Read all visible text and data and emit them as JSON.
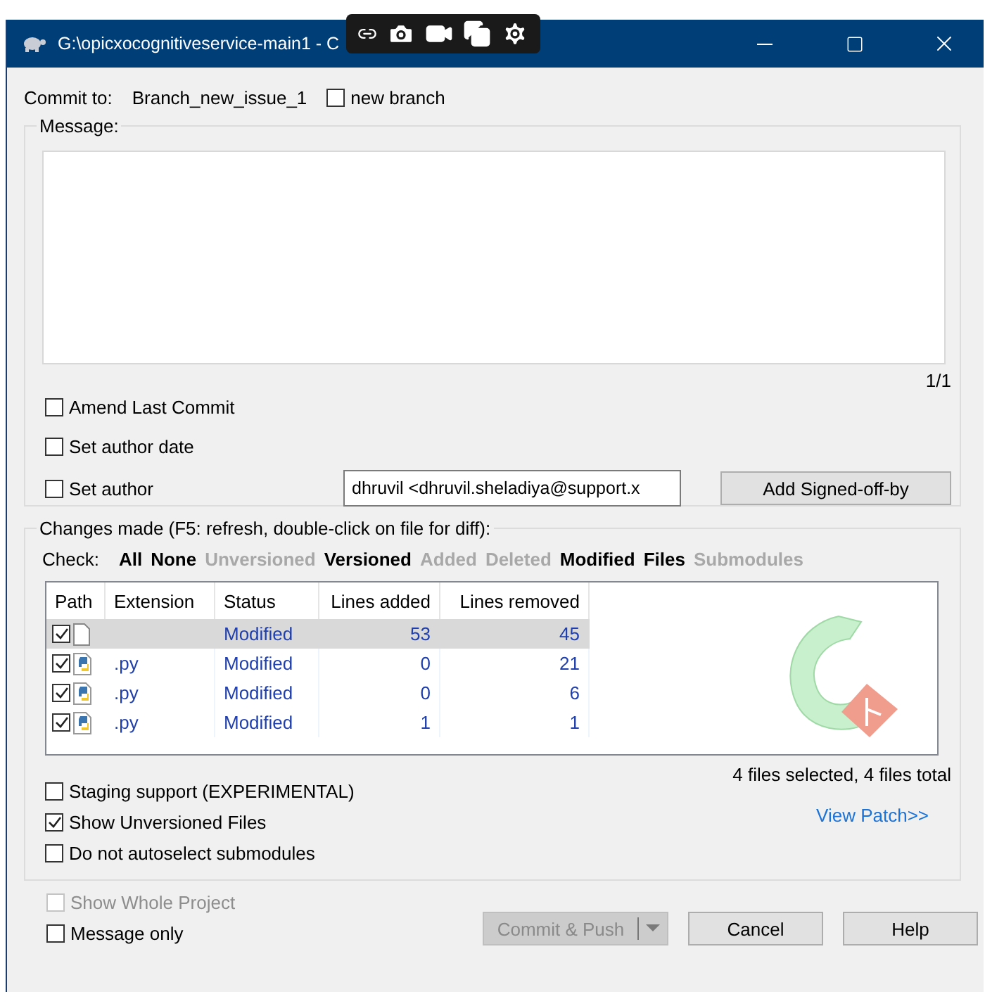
{
  "screen_overlay": {
    "tools": [
      {
        "kind": "link"
      },
      {
        "kind": "camera"
      },
      {
        "kind": "video"
      },
      {
        "kind": "windows"
      },
      {
        "kind": "settings"
      }
    ]
  },
  "window": {
    "title": "G:\\opicxocognitiveservice-main1 - C"
  },
  "commit_to": {
    "label": "Commit to:",
    "branch": "Branch_new_issue_1",
    "new_branch": {
      "label": "new branch",
      "checked": false
    }
  },
  "message": {
    "legend": "Message:",
    "counter": "1/1"
  },
  "options": [
    {
      "label": "Amend Last Commit",
      "checked": false
    },
    {
      "label": "Set author date",
      "checked": false
    },
    {
      "label": "Set author",
      "checked": false
    }
  ],
  "author_field": {
    "value": "dhruvil <dhruvil.sheladiya@support.x"
  },
  "signoff_button": "Add Signed-off-by",
  "changes": {
    "legend": "Changes made (F5: refresh, double-click on file for diff):",
    "check_label": "Check:",
    "filters": [
      {
        "label": "All",
        "disabled": false
      },
      {
        "label": "None",
        "disabled": false
      },
      {
        "label": "Unversioned",
        "disabled": true
      },
      {
        "label": "Versioned",
        "disabled": false
      },
      {
        "label": "Added",
        "disabled": true
      },
      {
        "label": "Deleted",
        "disabled": true
      },
      {
        "label": "Modified",
        "disabled": false
      },
      {
        "label": "Files",
        "disabled": false
      },
      {
        "label": "Submodules",
        "disabled": true
      }
    ],
    "columns": [
      "Path",
      "Extension",
      "Status",
      "Lines added",
      "Lines removed"
    ],
    "rows": [
      {
        "checked": true,
        "selected": true,
        "kind": "file",
        "status": "Modified",
        "lines_added": "53",
        "lines_removed": "45"
      },
      {
        "checked": true,
        "selected": false,
        "kind": "python",
        "extension": ".py",
        "status": "Modified",
        "lines_added": "0",
        "lines_removed": "21"
      },
      {
        "checked": true,
        "selected": false,
        "kind": "python",
        "extension": ".py",
        "status": "Modified",
        "lines_added": "0",
        "lines_removed": "6"
      },
      {
        "checked": true,
        "selected": false,
        "kind": "python",
        "extension": ".py",
        "status": "Modified",
        "lines_added": "1",
        "lines_removed": "1"
      }
    ],
    "summary": "4 files selected, 4 files total",
    "view_patch": "View Patch>>",
    "options": [
      {
        "label": "Staging support (EXPERIMENTAL)",
        "checked": false
      },
      {
        "label": "Show Unversioned Files",
        "checked": true
      },
      {
        "label": "Do not autoselect submodules",
        "checked": false
      }
    ]
  },
  "footer_options": [
    {
      "label": "Show Whole Project",
      "checked": false,
      "disabled": true
    },
    {
      "label": "Message only",
      "checked": false,
      "disabled": false
    }
  ],
  "buttons": [
    {
      "label": "Commit & Push",
      "kind": "split",
      "disabled": true
    },
    {
      "label": "Cancel",
      "kind": "plain",
      "disabled": false
    },
    {
      "label": "Help",
      "kind": "plain",
      "disabled": false
    }
  ]
}
